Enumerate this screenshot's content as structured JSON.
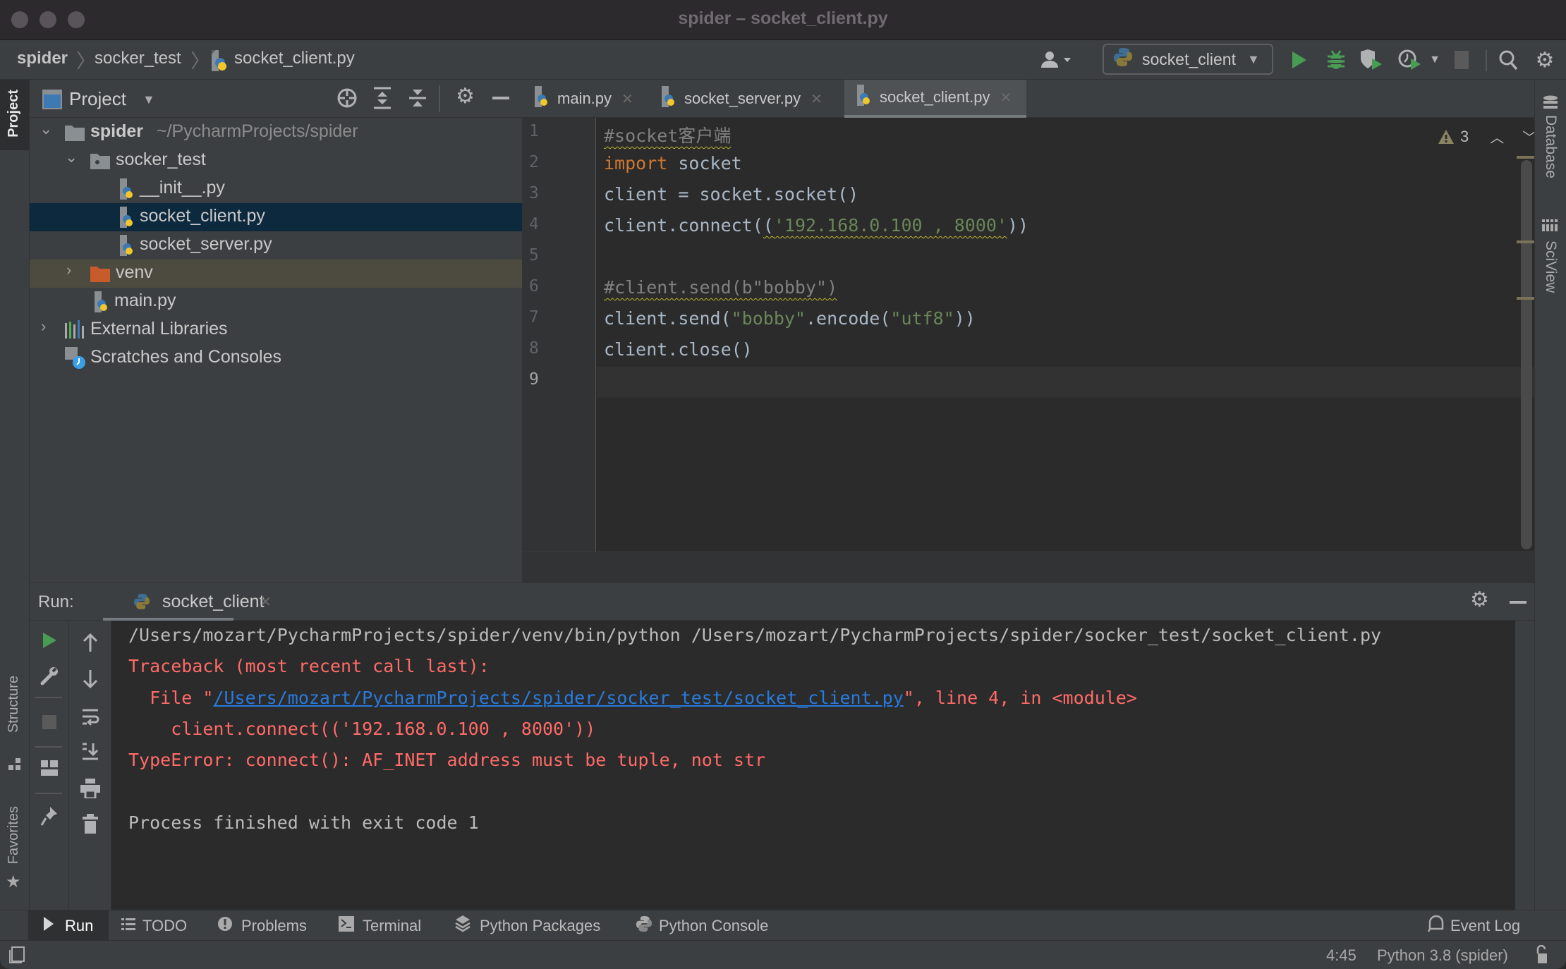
{
  "window": {
    "title": "spider – socket_client.py"
  },
  "navbar": {
    "breadcrumbs": [
      {
        "label": "spider",
        "bold": true
      },
      {
        "label": "socker_test"
      },
      {
        "label": "socket_client.py",
        "icon": "python-file-icon"
      }
    ],
    "run_config": "socket_client",
    "actions": [
      "user-icon",
      "run-icon",
      "debug-icon",
      "coverage-icon",
      "profile-icon",
      "stop-icon",
      "search-icon",
      "settings-icon"
    ]
  },
  "left_strip": {
    "tabs": [
      {
        "label": "Project",
        "active": true
      },
      {
        "label": "Structure"
      },
      {
        "label": "Favorites"
      }
    ]
  },
  "project_panel": {
    "title": "Project",
    "tree": [
      {
        "label": "spider",
        "hint": "~/PycharmProjects/spider",
        "type": "folder",
        "expanded": true,
        "depth": 0
      },
      {
        "label": "socker_test",
        "type": "package",
        "expanded": true,
        "depth": 1
      },
      {
        "label": "__init__.py",
        "type": "python-file",
        "depth": 2
      },
      {
        "label": "socket_client.py",
        "type": "python-file",
        "depth": 2,
        "selected": true
      },
      {
        "label": "socket_server.py",
        "type": "python-file",
        "depth": 2
      },
      {
        "label": "venv",
        "type": "excluded-folder",
        "expanded": false,
        "depth": 1
      },
      {
        "label": "main.py",
        "type": "python-file",
        "depth": 1
      },
      {
        "label": "External Libraries",
        "type": "libraries",
        "expanded": false,
        "depth": 0
      },
      {
        "label": "Scratches and Consoles",
        "type": "scratches",
        "depth": 0
      }
    ]
  },
  "editor": {
    "tabs": [
      {
        "label": "main.py",
        "active": false
      },
      {
        "label": "socket_server.py",
        "active": false
      },
      {
        "label": "socket_client.py",
        "active": true
      }
    ],
    "warning_count": "3",
    "current_line": 9,
    "lines": [
      {
        "n": "1",
        "segments": [
          {
            "t": "#socket客户端",
            "c": "cm",
            "warn": true
          }
        ]
      },
      {
        "n": "2",
        "segments": [
          {
            "t": "import",
            "c": "kw"
          },
          {
            "t": " socket",
            "c": ""
          }
        ]
      },
      {
        "n": "3",
        "segments": [
          {
            "t": "client = socket.socket()",
            "c": ""
          }
        ]
      },
      {
        "n": "4",
        "segments": [
          {
            "t": "client.connect(",
            "c": ""
          },
          {
            "t": "(",
            "c": "",
            "warn": true
          },
          {
            "t": "'192.168.0.100 , 8000'",
            "c": "str",
            "warn": true
          },
          {
            "t": "))",
            "c": ""
          }
        ]
      },
      {
        "n": "5",
        "segments": []
      },
      {
        "n": "6",
        "segments": [
          {
            "t": "#client.send(b\"bobby\")",
            "c": "cm",
            "warn": true
          }
        ]
      },
      {
        "n": "7",
        "segments": [
          {
            "t": "client.send(",
            "c": ""
          },
          {
            "t": "\"bobby\"",
            "c": "str"
          },
          {
            "t": ".encode(",
            "c": ""
          },
          {
            "t": "\"utf8\"",
            "c": "str"
          },
          {
            "t": "))",
            "c": ""
          }
        ]
      },
      {
        "n": "8",
        "segments": [
          {
            "t": "client.close()",
            "c": ""
          }
        ]
      },
      {
        "n": "9",
        "segments": []
      }
    ]
  },
  "right_strip": {
    "tabs": [
      {
        "label": "Database"
      },
      {
        "label": "SciView"
      }
    ]
  },
  "run_panel": {
    "label": "Run:",
    "tab": "socket_client",
    "console": [
      {
        "parts": [
          {
            "t": "/Users/mozart/PycharmProjects/spider/venv/bin/python /Users/mozart/PycharmProjects/spider/socker_test/socket_client.py",
            "c": "con-normal"
          }
        ]
      },
      {
        "parts": [
          {
            "t": "Traceback (most recent call last):",
            "c": "con-err"
          }
        ]
      },
      {
        "parts": [
          {
            "t": "  File \"",
            "c": "con-err"
          },
          {
            "t": "/Users/mozart/PycharmProjects/spider/socker_test/socket_client.py",
            "c": "con-link"
          },
          {
            "t": "\", line 4, in <module>",
            "c": "con-err"
          }
        ]
      },
      {
        "parts": [
          {
            "t": "    client.connect(('192.168.0.100 , 8000'))",
            "c": "con-err"
          }
        ]
      },
      {
        "parts": [
          {
            "t": "TypeError: connect(): AF_INET address must be tuple, not str",
            "c": "con-err"
          }
        ]
      },
      {
        "parts": []
      },
      {
        "parts": [
          {
            "t": "Process finished with exit code 1",
            "c": "con-normal"
          }
        ]
      }
    ]
  },
  "bottom_tools": [
    {
      "label": "Run",
      "icon": "play-icon",
      "active": true
    },
    {
      "label": "TODO",
      "icon": "list-icon"
    },
    {
      "label": "Problems",
      "icon": "problems-icon"
    },
    {
      "label": "Terminal",
      "icon": "terminal-icon"
    },
    {
      "label": "Python Packages",
      "icon": "packages-icon"
    },
    {
      "label": "Python Console",
      "icon": "python-icon"
    }
  ],
  "event_log": "Event Log",
  "status": {
    "position": "4:45",
    "interpreter": "Python 3.8 (spider)"
  },
  "colors": {
    "keyword": "#cc7832",
    "string": "#6a8759",
    "comment": "#808080",
    "error": "#ff6b68",
    "link": "#287bde",
    "run_green": "#499c54",
    "selection": "#0d293e"
  }
}
